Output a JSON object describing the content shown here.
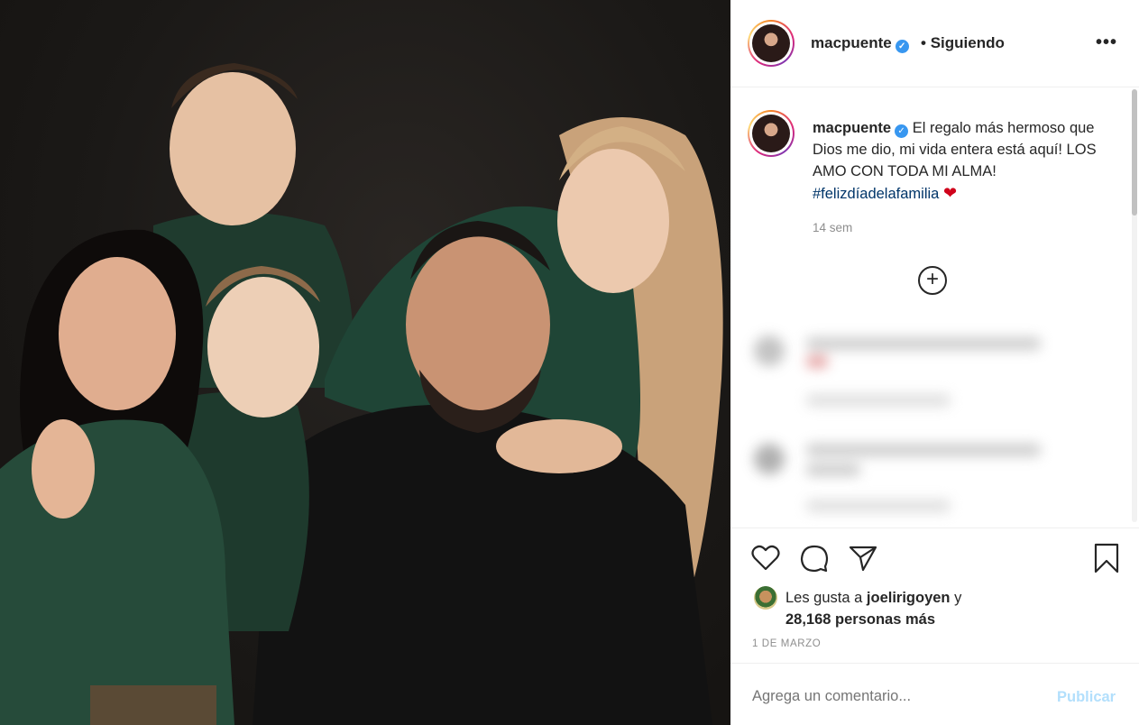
{
  "post": {
    "image_alt": "Family portrait: six people in dark green clothing against a dark background"
  },
  "header": {
    "username": "macpuente",
    "verified_icon": "verified-badge-icon",
    "separator": "•",
    "follow_status": "Siguiendo",
    "more_icon": "more-options-icon"
  },
  "caption": {
    "username": "macpuente",
    "text": "El regalo más hermoso que Dios me dio, mi vida entera está aquí! LOS AMO CON TODA MI ALMA!",
    "hashtag": "#felizdíadelafamilia",
    "emoji": "❤",
    "time_ago": "14 sem"
  },
  "load_more_icon": "plus-circle-icon",
  "actions": {
    "like_icon": "heart-icon",
    "comment_icon": "comment-icon",
    "share_icon": "paper-plane-icon",
    "save_icon": "bookmark-icon"
  },
  "likes": {
    "prefix": "Les gusta a",
    "user": "joelirigoyen",
    "conjunction": "y",
    "count_text": "28,168 personas más"
  },
  "date": "1 DE MARZO",
  "comment_box": {
    "placeholder": "Agrega un comentario...",
    "publish_label": "Publicar"
  },
  "colors": {
    "verified": "#3897f0",
    "hashtag": "#003569",
    "publish_disabled": "#b2dffc",
    "muted": "#8e8e8e"
  }
}
